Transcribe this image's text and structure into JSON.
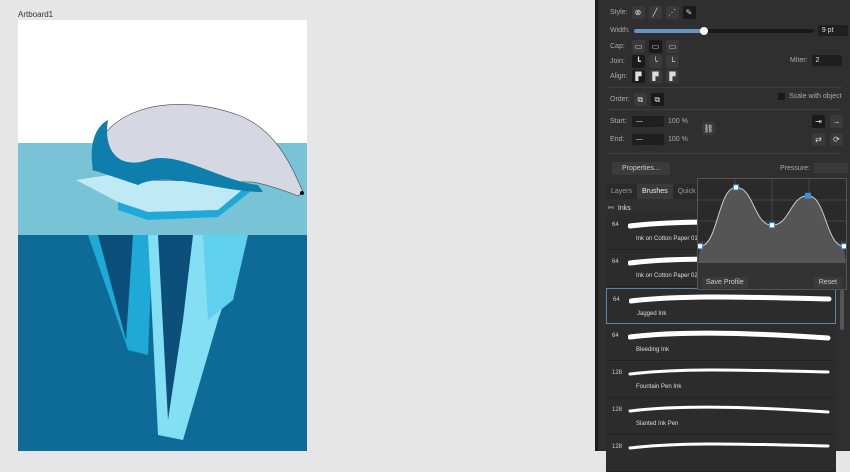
{
  "canvas": {
    "artboard_label": "Artboard1",
    "colors": {
      "sky": "#ffffff",
      "sea_surface": "#79c3d6",
      "deep_sea": "#0e6a96",
      "ice": "#84dff5"
    }
  },
  "stroke_panel": {
    "style_label": "Style:",
    "width_label": "Width:",
    "width_value": "9 pt",
    "width_fraction": 0.38,
    "cap_label": "Cap:",
    "join_label": "Join:",
    "align_label": "Align:",
    "miter_label": "Miter:",
    "miter_value": "2",
    "order_label": "Order:",
    "scale_label": "Scale with object",
    "start_label": "Start:",
    "end_label": "End:",
    "start_pct": "100 %",
    "end_pct": "100 %",
    "properties_label": "Properties...",
    "pressure_label": "Pressure:"
  },
  "tabs": [
    {
      "label": "Layers"
    },
    {
      "label": "Brushes",
      "active": true
    },
    {
      "label": "Quick"
    }
  ],
  "category": "Inks",
  "brushes": [
    {
      "size": "64",
      "name": "Ink on Cotton Paper 01"
    },
    {
      "size": "64",
      "name": "Ink on Cotton Paper 02"
    },
    {
      "size": "64",
      "name": "Jagged Ink",
      "selected": true
    },
    {
      "size": "64",
      "name": "Bleeding Ink"
    },
    {
      "size": "128",
      "name": "Fountain Pen Ink"
    },
    {
      "size": "128",
      "name": "Slanted Ink Pen"
    },
    {
      "size": "128",
      "name": ""
    }
  ],
  "pressure_popup": {
    "save_label": "Save Profile",
    "reset_label": "Reset",
    "points": [
      [
        0,
        0.2
      ],
      [
        0.25,
        0.9
      ],
      [
        0.5,
        0.45
      ],
      [
        0.75,
        0.8
      ],
      [
        1,
        0.2
      ]
    ]
  }
}
